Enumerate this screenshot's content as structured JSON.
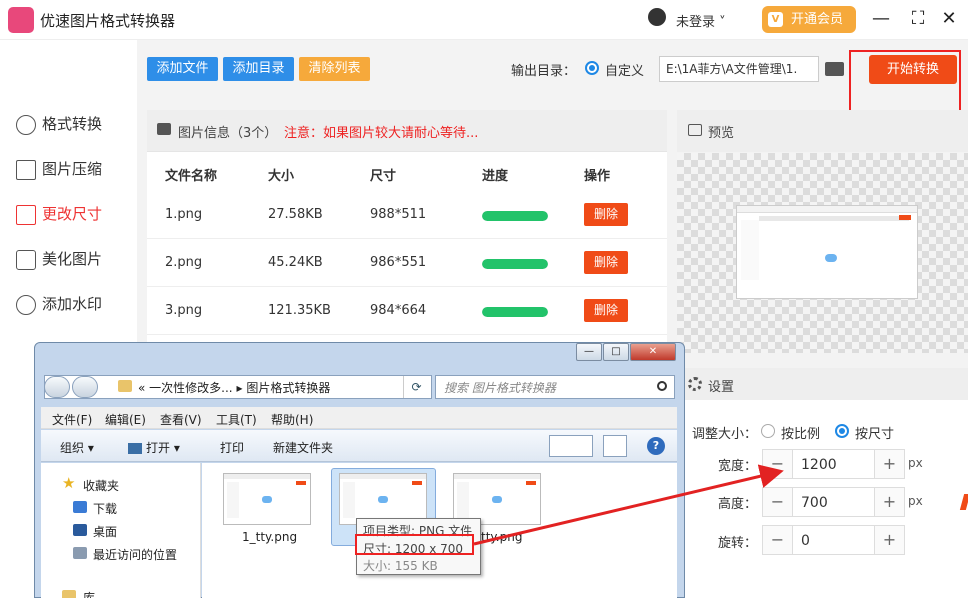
{
  "app": {
    "title": "优速图片格式转换器",
    "user_label": "未登录",
    "vip_label": "开通会员",
    "vip_badge": "V"
  },
  "sidebar": {
    "items": [
      {
        "label": "格式转换"
      },
      {
        "label": "图片压缩"
      },
      {
        "label": "更改尺寸",
        "active": true
      },
      {
        "label": "美化图片"
      },
      {
        "label": "添加水印"
      }
    ]
  },
  "toolbar": {
    "add_file": "添加文件",
    "add_dir": "添加目录",
    "clear_list": "清除列表",
    "output_label": "输出目录：",
    "custom_label": "自定义",
    "output_path": "E:\\1A菲方\\A文件管理\\1.",
    "start_label": "开始转换"
  },
  "info": {
    "title": "图片信息（3个）",
    "note": "注意：如果图片较大请耐心等待..."
  },
  "table": {
    "headers": [
      "文件名称",
      "大小",
      "尺寸",
      "进度",
      "操作"
    ],
    "rows": [
      {
        "name": "1.png",
        "size": "27.58KB",
        "dims": "988*511",
        "progress": 1.0,
        "action": "删除"
      },
      {
        "name": "2.png",
        "size": "45.24KB",
        "dims": "986*551",
        "progress": 1.0,
        "action": "删除"
      },
      {
        "name": "3.png",
        "size": "121.35KB",
        "dims": "984*664",
        "progress": 1.0,
        "action": "删除"
      }
    ]
  },
  "preview": {
    "title": "预览"
  },
  "settings": {
    "title": "设置",
    "resize_label": "调整大小：",
    "opt_ratio": "按比例",
    "opt_size": "按尺寸",
    "width_label": "宽度：",
    "width_value": "1200",
    "height_label": "高度：",
    "height_value": "700",
    "rotate_label": "旋转：",
    "rotate_value": "0",
    "unit": "px",
    "minus": "−",
    "plus": "+"
  },
  "explorer": {
    "ctl_min": "—",
    "ctl_max": "□",
    "ctl_close": "✕",
    "address_prefix": "«",
    "address_1": "一次性修改多...",
    "address_sep": "▸",
    "address_2": "图片格式转换器",
    "search_placeholder": "搜索 图片格式转换器",
    "menus": [
      "文件(F)",
      "编辑(E)",
      "查看(V)",
      "工具(T)",
      "帮助(H)"
    ],
    "cmds": {
      "organize": "组织 ▾",
      "open": "打开 ▾",
      "print": "打印",
      "new_folder": "新建文件夹"
    },
    "nav": {
      "favorites": "收藏夹",
      "downloads": "下载",
      "desktop": "桌面",
      "recent": "最近访问的位置",
      "library": "库"
    },
    "files": [
      "1_tty.png",
      "tty.png"
    ],
    "tooltip": {
      "type": "项目类型: PNG 文件",
      "dims": "尺寸: 1200 x 700",
      "size": "大小: 155 KB"
    },
    "help": "?"
  },
  "colors": {
    "accent": "#f04b17",
    "blue": "#1e88e5",
    "green": "#22c36a",
    "red_highlight": "#e22222"
  }
}
